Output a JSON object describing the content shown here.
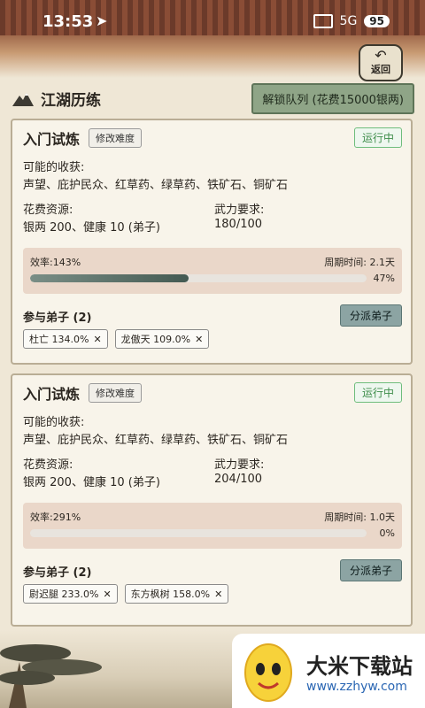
{
  "status_bar": {
    "time": "13:53",
    "network": "5G",
    "battery": "95"
  },
  "back_button": {
    "label": "返回"
  },
  "header": {
    "title": "江湖历练",
    "unlock_label": "解锁队列 (花费15000银两)"
  },
  "cards": [
    {
      "name": "入门试炼",
      "edit_label": "修改难度",
      "status": "运行中",
      "gains_label": "可能的收获:",
      "gains": "声望、庇护民众、红草药、绿草药、铁矿石、铜矿石",
      "cost_label": "花费资源:",
      "cost": "银两 200、健康 10 (弟子)",
      "power_label": "武力要求:",
      "power": "180/100",
      "efficiency": "效率:143%",
      "cycle": "周期时间: 2.1天",
      "progress_pct": "47%",
      "progress": 0.47,
      "members_label": "参与弟子 (2)",
      "assign_label": "分派弟子",
      "members": [
        "杜亡 134.0%",
        "龙傲天 109.0%"
      ]
    },
    {
      "name": "入门试炼",
      "edit_label": "修改难度",
      "status": "运行中",
      "gains_label": "可能的收获:",
      "gains": "声望、庇护民众、红草药、绿草药、铁矿石、铜矿石",
      "cost_label": "花费资源:",
      "cost": "银两 200、健康 10 (弟子)",
      "power_label": "武力要求:",
      "power": "204/100",
      "efficiency": "效率:291%",
      "cycle": "周期时间: 1.0天",
      "progress_pct": "0%",
      "progress": 0,
      "members_label": "参与弟子 (2)",
      "assign_label": "分派弟子",
      "members": [
        "尉迟腿 233.0%",
        "东方枫树 158.0%"
      ]
    }
  ],
  "watermark": {
    "title": "大米下载站",
    "url": "www.zzhyw.com"
  },
  "colors": {
    "accent_green": "#8fa587",
    "assign_teal": "#8ca4a3",
    "running_green": "#3e8d4a",
    "progress_dark": "#445a52"
  },
  "icons": [
    "navigation-arrow-icon",
    "signal-icon",
    "back-arrow-icon",
    "mountain-icon",
    "close-icon"
  ]
}
